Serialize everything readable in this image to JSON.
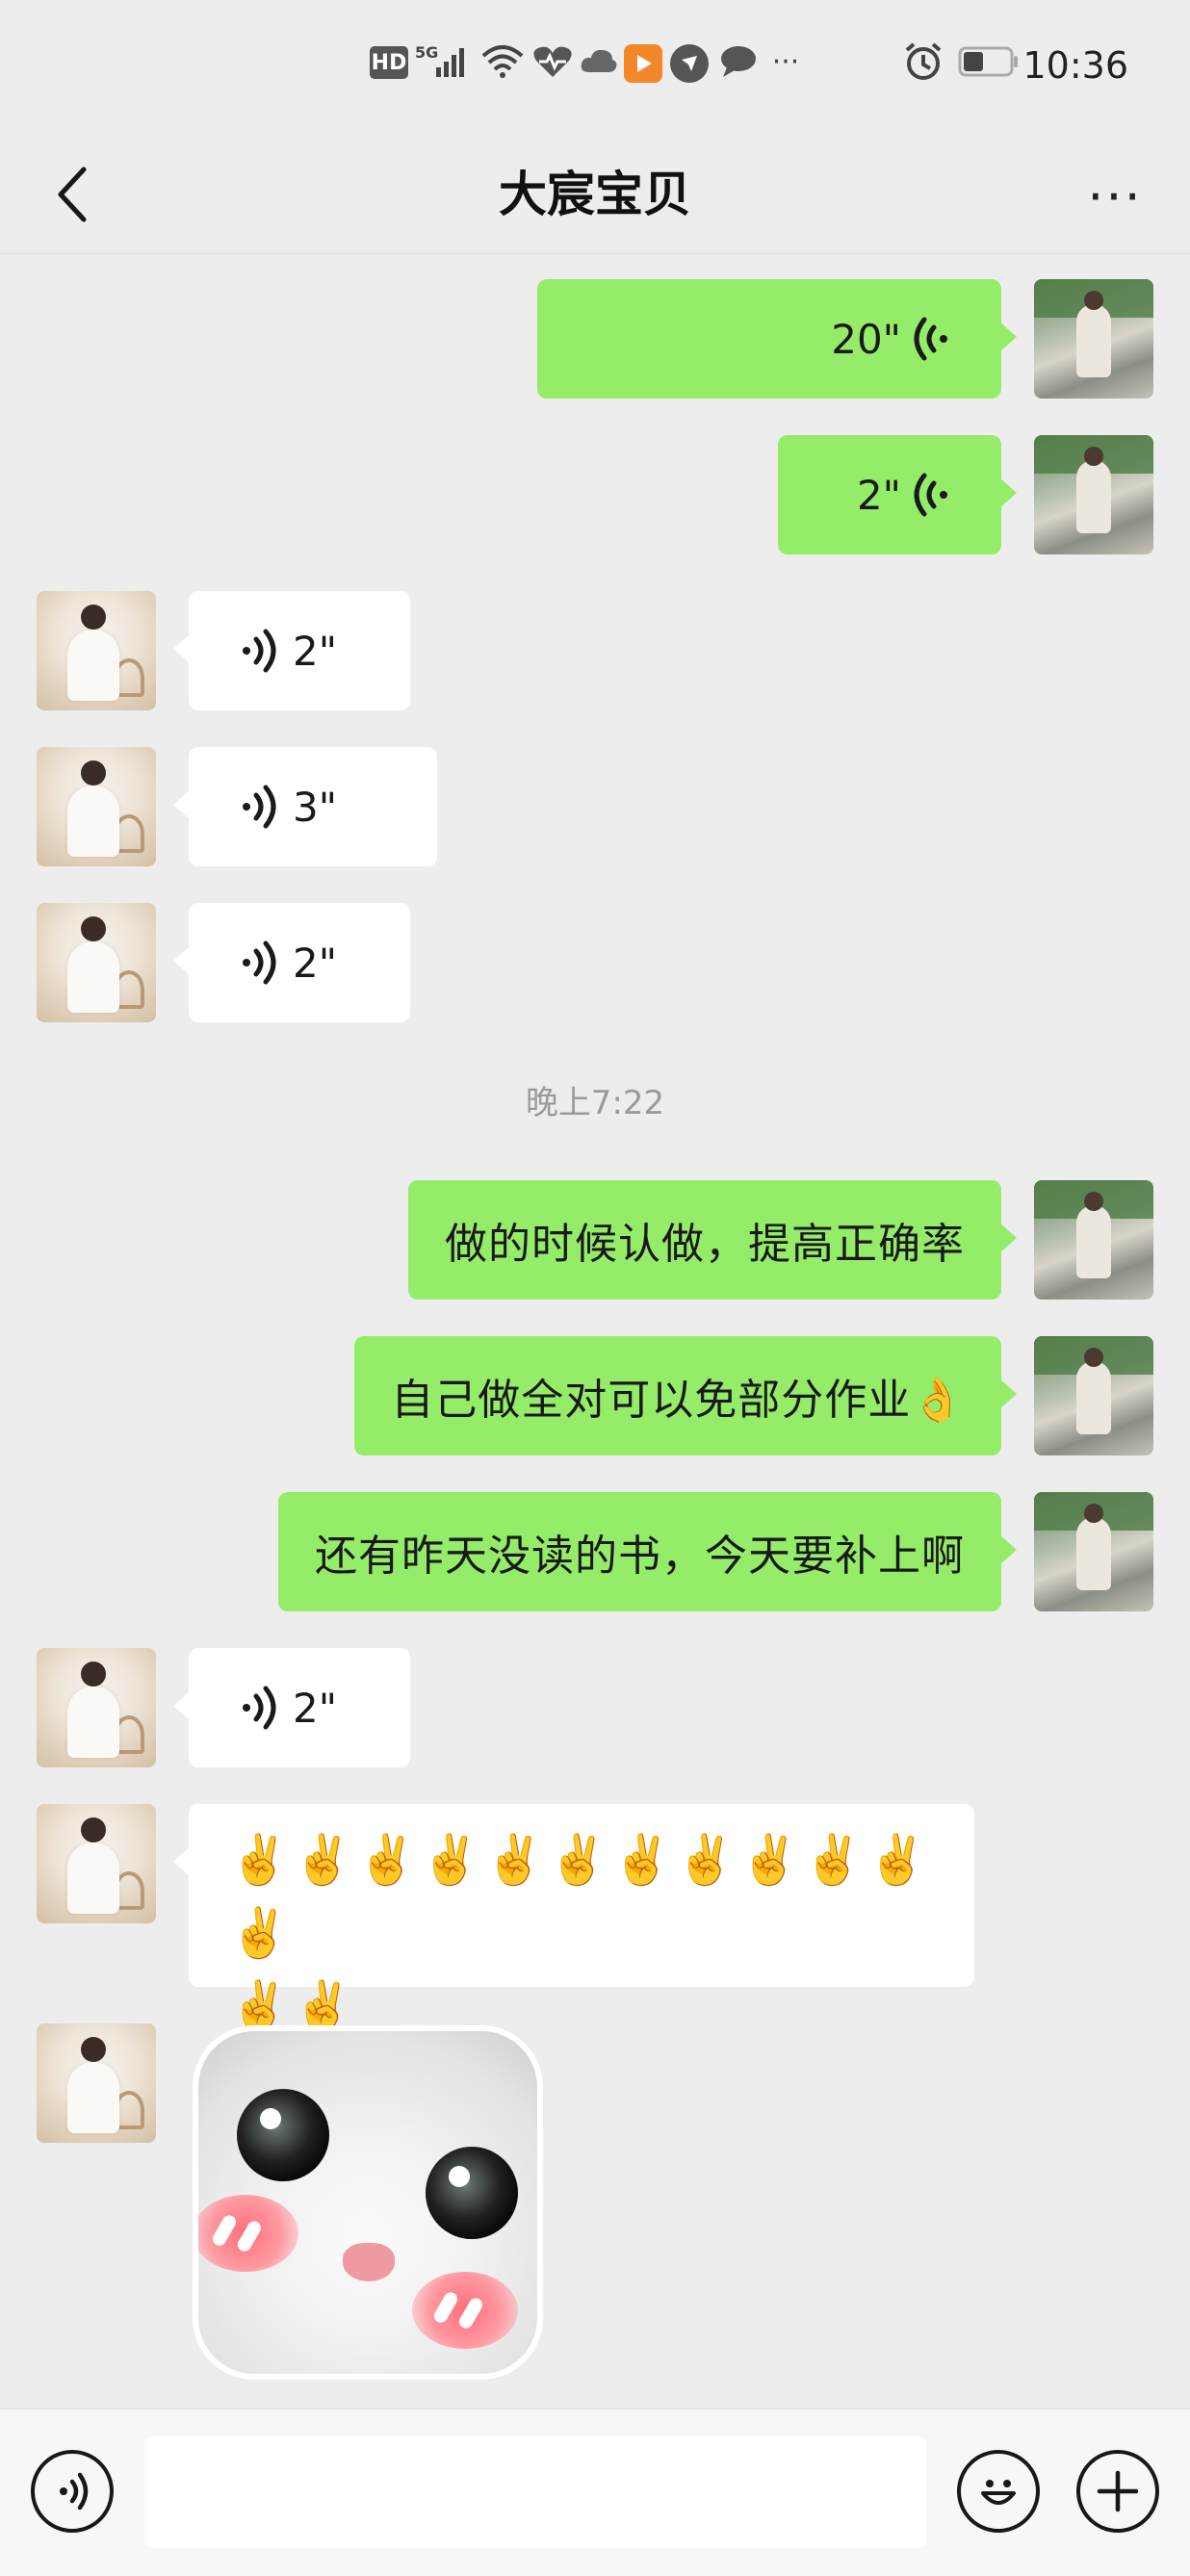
{
  "status_bar": {
    "time": "10:36",
    "indicators": [
      "hd-icon",
      "signal-5g-icon",
      "wifi-icon",
      "health-icon",
      "cloud-icon",
      "video-app-icon",
      "app-icon",
      "message-icon",
      "more-dots",
      "alarm-icon",
      "battery-icon"
    ],
    "hd_label": "HD",
    "fiveg_label": "5G"
  },
  "nav": {
    "title": "大宸宝贝",
    "more_label": "···"
  },
  "messages": [
    {
      "side": "sent",
      "type": "voice",
      "duration": "20\""
    },
    {
      "side": "sent",
      "type": "voice",
      "duration": "2\""
    },
    {
      "side": "received",
      "type": "voice",
      "duration": "2\""
    },
    {
      "side": "received",
      "type": "voice",
      "duration": "3\""
    },
    {
      "side": "received",
      "type": "voice",
      "duration": "2\""
    },
    {
      "side": "sent",
      "type": "text",
      "text": "做的时候认做，提高正确率"
    },
    {
      "side": "sent",
      "type": "text",
      "text": "自己做全对可以免部分作业👌"
    },
    {
      "side": "sent",
      "type": "text",
      "text": "还有昨天没读的书，今天要补上啊"
    },
    {
      "side": "received",
      "type": "voice",
      "duration": "2\""
    },
    {
      "side": "received",
      "type": "emoji",
      "line1": "✌️✌️✌️✌️✌️✌️✌️✌️✌️✌️✌️✌️",
      "line2": "✌️✌️"
    },
    {
      "side": "received",
      "type": "sticker",
      "sticker": "blushing-cat-sticker"
    }
  ],
  "timestamp": "晚上7:22",
  "colors": {
    "sent_bubble": "#95ec69",
    "received_bubble": "#ffffff",
    "background": "#ededed"
  }
}
